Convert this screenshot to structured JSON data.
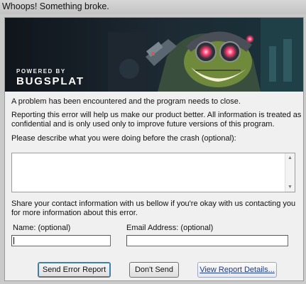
{
  "window": {
    "title": "Whoops! Something broke."
  },
  "banner": {
    "powered_by": "POWERED BY",
    "brand": "BUGSPLAT"
  },
  "messages": {
    "problem": "A problem has been encountered and the program needs to close.",
    "reporting_line1": "Reporting this error will help us make our product better. All information is treated as",
    "reporting_line2": "confidential and is only used only to improve future versions of this program.",
    "describe_label": "Please describe what you were doing before the crash (optional):",
    "contact_line1": "Share your contact information with us bellow if you're okay with us contacting you",
    "contact_line2": "for more information about this error."
  },
  "form": {
    "name_label": "Name: (optional)",
    "name_value": "",
    "email_label": "Email Address: (optional)",
    "email_value": "",
    "description_value": ""
  },
  "buttons": {
    "send": "Send Error Report",
    "dont_send": "Don't Send",
    "details": "View Report Details..."
  },
  "icons": {
    "scroll_up": "scroll-up-arrow-icon",
    "scroll_down": "scroll-down-arrow-icon",
    "banner_art": "robot-yordle-illustration"
  },
  "colors": {
    "banner_bg": "#141a21",
    "content_bg": "#f0f0f0",
    "link": "#1b3c9c"
  }
}
